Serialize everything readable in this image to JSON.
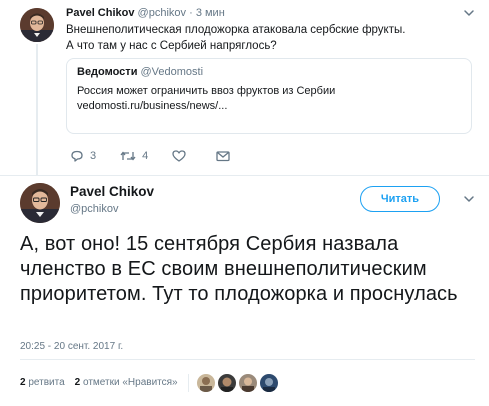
{
  "parent_tweet": {
    "author_name": "Pavel Chikov",
    "author_handle": "@pchikov",
    "separator": "·",
    "time": "3 мин",
    "text_line1": "Внешнеполитическая плодожорка атаковала сербские фрукты.",
    "text_line2": "А что там у нас с Сербией напряглось?",
    "quote": {
      "source_name": "Ведомости",
      "source_handle": "@Vedomosti",
      "text": "Россия может ограничить ввоз фруктов из Сербии",
      "link": "vedomosti.ru/business/news/..."
    },
    "actions": {
      "reply_count": "3",
      "retweet_count": "4",
      "like_count": ""
    }
  },
  "main_tweet": {
    "author_name": "Pavel Chikov",
    "author_handle": "@pchikov",
    "follow_label": "Читать",
    "text": "А, вот оно! 15 сентября Сербия назвала членство в ЕС своим внешнеполитическим приоритетом. Тут то плодожорка и проснулась",
    "timestamp": "20:25 - 20 сент. 2017 г.",
    "retweets_count": "2",
    "retweets_label": "ретвита",
    "likes_count": "2",
    "likes_label": "отметки «Нравится»"
  },
  "icons": {
    "reply": "reply-icon",
    "retweet": "retweet-icon",
    "like": "heart-icon",
    "message": "envelope-icon",
    "chevron": "chevron-down-icon"
  },
  "colors": {
    "accent": "#1da1f2",
    "text": "#14171a",
    "secondary": "#657786",
    "border": "#e6ecf0"
  }
}
